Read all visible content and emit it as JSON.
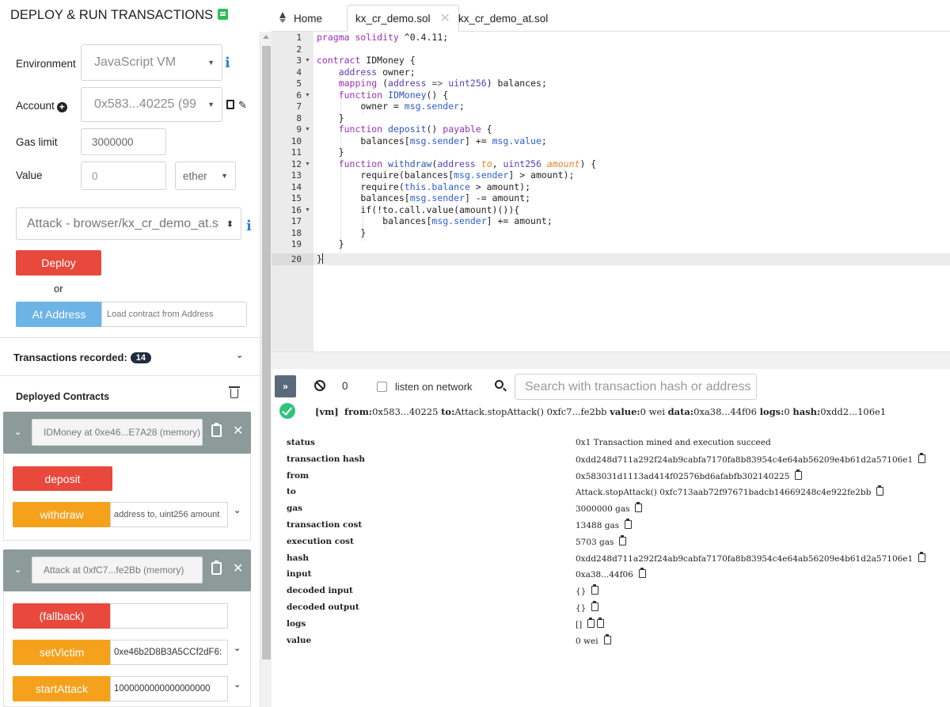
{
  "panel": {
    "title": "DEPLOY & RUN TRANSACTIONS",
    "environment_label": "Environment",
    "environment_value": "JavaScript VM",
    "account_label": "Account",
    "account_value": "0x583...40225 (99",
    "gas_limit_label": "Gas limit",
    "gas_limit_value": "3000000",
    "value_label": "Value",
    "value_value": "0",
    "value_unit": "ether",
    "contract_select": "Attack - browser/kx_cr_demo_at.s",
    "deploy_label": "Deploy",
    "or_label": "or",
    "at_address_label": "At Address",
    "at_address_placeholder": "Load contract from Address",
    "transactions_recorded_label": "Transactions recorded:",
    "transactions_recorded_count": "14",
    "deployed_contracts_label": "Deployed Contracts"
  },
  "contracts": [
    {
      "address_label": "IDMoney at 0xe46...E7A28 (memory)",
      "functions": [
        {
          "label": "deposit",
          "input": ""
        },
        {
          "label": "withdraw",
          "input": "address to, uint256 amount"
        }
      ]
    },
    {
      "address_label": "Attack at 0xfC7...fe2Bb (memory)",
      "functions": [
        {
          "label": "(fallback)",
          "input": ""
        },
        {
          "label": "setVictim",
          "input": "0xe46b2D8B3A5CCf2dF6:"
        },
        {
          "label": "startAttack",
          "input": "1000000000000000000"
        }
      ]
    }
  ],
  "tabs": [
    {
      "label": "Home"
    },
    {
      "label": "kx_cr_demo.sol"
    },
    {
      "label": "kx_cr_demo_at.sol"
    }
  ],
  "editor": {
    "line_numbers": [
      "1",
      "2",
      "3",
      "4",
      "5",
      "6",
      "7",
      "8",
      "9",
      "10",
      "11",
      "12",
      "13",
      "14",
      "15",
      "16",
      "17",
      "18",
      "19",
      "20"
    ]
  },
  "terminal": {
    "count": "0",
    "listen_label": "listen on network",
    "search_placeholder": "Search with transaction hash or address",
    "tx_summary": {
      "vm": "[vm]",
      "from_label": "from:",
      "from": "0x583...40225",
      "to_label": "to:",
      "to": "Attack.stopAttack() 0xfc7...fe2bb",
      "value_label": "value:",
      "value": "0 wei",
      "data_label": "data:",
      "data": "0xa38...44f06",
      "logs_label": "logs:",
      "logs": "0",
      "hash_label": "hash:",
      "hash": "0xdd2...106e1"
    },
    "details": [
      {
        "key": "status",
        "value": "0x1 Transaction mined and execution succeed",
        "copy": 0
      },
      {
        "key": "transaction hash",
        "value": "0xdd248d711a292f24ab9cabfa7170fa8b83954c4e64ab56209e4b61d2a57106e1",
        "copy": 1
      },
      {
        "key": "from",
        "value": "0x583031d1113ad414f02576bd6afabfb302140225",
        "copy": 1
      },
      {
        "key": "to",
        "value": "Attack.stopAttack() 0xfc713aab72f97671badcb14669248c4e922fe2bb",
        "copy": 1
      },
      {
        "key": "gas",
        "value": "3000000 gas",
        "copy": 1
      },
      {
        "key": "transaction cost",
        "value": "13488 gas",
        "copy": 1
      },
      {
        "key": "execution cost",
        "value": "5703 gas",
        "copy": 1
      },
      {
        "key": "hash",
        "value": "0xdd248d711a292f24ab9cabfa7170fa8b83954c4e64ab56209e4b61d2a57106e1",
        "copy": 1
      },
      {
        "key": "input",
        "value": "0xa38...44f06",
        "copy": 1
      },
      {
        "key": "decoded input",
        "value": "{}",
        "copy": 1
      },
      {
        "key": "decoded output",
        "value": "{}",
        "copy": 1
      },
      {
        "key": "logs",
        "value": "[]",
        "copy": 2
      },
      {
        "key": "value",
        "value": "0 wei",
        "copy": 1
      }
    ]
  },
  "colors": {
    "deploy_red": "#e8493c",
    "at_address_blue": "#6cb3e6",
    "function_orange": "#f5a11c",
    "contract_header": "#8c9a9a",
    "success_green": "#31c27c",
    "info_blue": "#2f82d6"
  },
  "icons": [
    "book-icon",
    "info-icon",
    "plus-circle-icon",
    "clipboard-icon",
    "edit-icon",
    "chevron-down-icon",
    "trash-icon",
    "close-icon",
    "home-icon",
    "double-chevron-icon",
    "ban-icon",
    "search-icon",
    "check-circle-icon"
  ]
}
